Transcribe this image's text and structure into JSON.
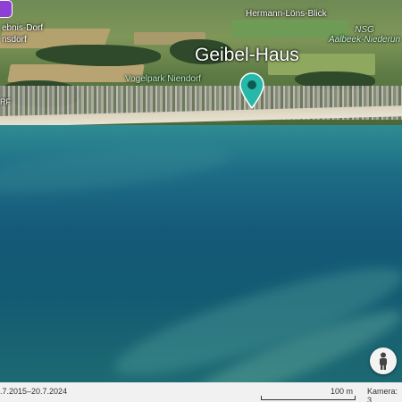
{
  "map": {
    "poi": {
      "name": "Geibel-Haus",
      "pin_color": "#26b8a8"
    },
    "labels": {
      "top_left_1": "ebnis-Dorf",
      "top_left_2": "nsdorf",
      "hermann": "Hermann-Löns-Blick",
      "nsg_line1": "NSG",
      "nsg_line2": "Aalbeek-Niederun",
      "vogelpark": "Vogelpark Niendorf",
      "left_edge": "RF"
    }
  },
  "footer": {
    "dates": ".7.2015–20.7.2024",
    "scale": "100 m",
    "camera": "Kamera: 3"
  },
  "icons": {
    "pegman": "pegman-icon",
    "pin": "map-pin-icon",
    "poi_marker": "purple-poi-icon"
  }
}
